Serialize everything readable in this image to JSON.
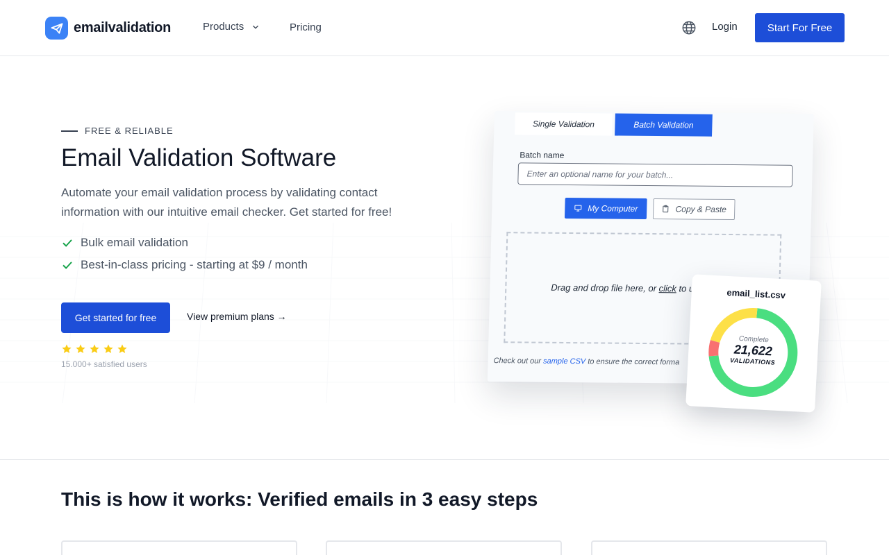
{
  "header": {
    "logo_text": "emailvalidation",
    "nav": {
      "products_label": "Products",
      "pricing_label": "Pricing"
    },
    "login_label": "Login",
    "start_label": "Start For Free"
  },
  "hero": {
    "eyebrow": "FREE & RELIABLE",
    "title": "Email Validation Software",
    "description": "Automate your email validation process by validating contact information with our intuitive email checker. Get started for free!",
    "features": [
      "Bulk email validation",
      "Best-in-class pricing - starting at $9 / month"
    ],
    "cta_label": "Get started for free",
    "premium_label": "View premium plans →",
    "rating": 5,
    "users_label": "15.000+ satisfied users"
  },
  "mockup": {
    "tab_single": "Single Validation",
    "tab_batch": "Batch Validation",
    "batch_label": "Batch name",
    "batch_placeholder": "Enter an optional name for your batch...",
    "btn_computer": "My Computer",
    "btn_paste": "Copy & Paste",
    "drop_prefix": "Drag and drop file here, or ",
    "drop_link": "click",
    "drop_suffix": " to upl",
    "sample_prefix": "Check out our ",
    "sample_link": "sample CSV",
    "sample_suffix": " to ensure the correct forma"
  },
  "csv_card": {
    "filename": "email_list.csv",
    "complete_label": "Complete",
    "count": "21,622",
    "count_label": "VALIDATIONS"
  },
  "chart_data": {
    "type": "pie",
    "series": [
      {
        "name": "",
        "values": [
          0.72,
          0.22,
          0.06
        ]
      }
    ],
    "colors": [
      "#4ade80",
      "#fde047",
      "#f87171"
    ]
  },
  "steps": {
    "title": "This is how it works: Verified emails in 3 easy steps"
  },
  "colors": {
    "brand": "#1d4ed8",
    "accent": "#2563eb",
    "check": "#16a34a",
    "star": "#facc15"
  }
}
